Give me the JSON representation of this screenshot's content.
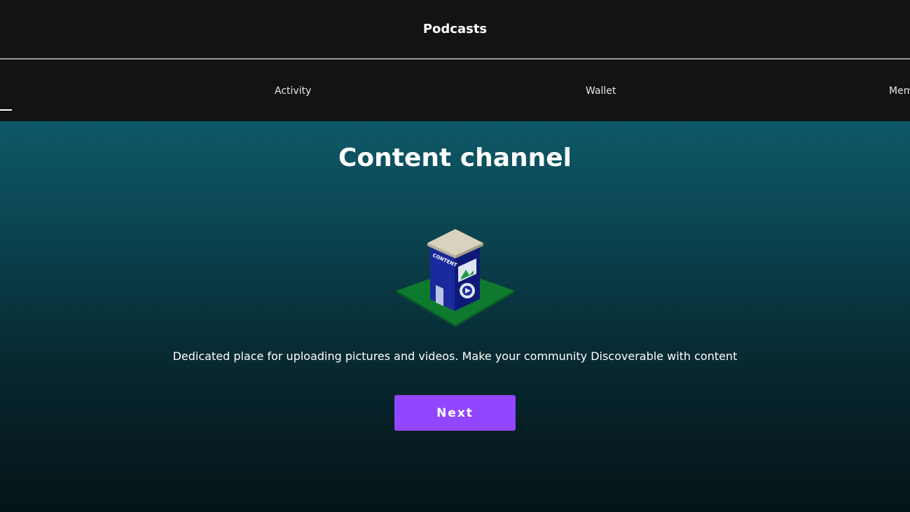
{
  "header": {
    "title": "Podcasts"
  },
  "tabs": [
    {
      "label": "Activity"
    },
    {
      "label": "Wallet"
    },
    {
      "label": "Mem"
    }
  ],
  "main": {
    "heading": "Content channel",
    "illustration": {
      "icon": "content-building-icon",
      "sign_text": "CONTENT"
    },
    "description": "Dedicated place for uploading pictures and videos. Make your community Discoverable with content",
    "next_label": "Next"
  },
  "colors": {
    "accent": "#9146ff",
    "background_top": "#0e5968",
    "background_bottom": "#041417",
    "header_bg": "#131313"
  }
}
